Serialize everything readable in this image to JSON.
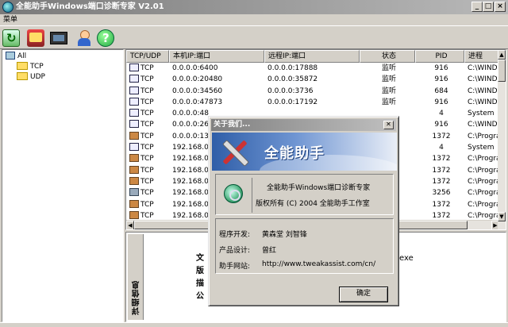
{
  "window": {
    "title": "全能助手Windows端口诊断专家 V2.01"
  },
  "menu": {
    "items": [
      "菜单"
    ]
  },
  "tree": {
    "items": [
      "All",
      "TCP",
      "UDP"
    ]
  },
  "table": {
    "columns": [
      "TCP/UDP",
      "本机IP:端口",
      "远程IP:端口",
      "状态",
      "PID",
      "进程"
    ],
    "rows": [
      {
        "icon": "window",
        "proto": "TCP",
        "local": "0.0.0.0:6400",
        "remote": "0.0.0.0:17888",
        "state": "监听",
        "pid": "916",
        "proc": "C:\\WIND"
      },
      {
        "icon": "window",
        "proto": "TCP",
        "local": "0.0.0.0:20480",
        "remote": "0.0.0.0:35872",
        "state": "监听",
        "pid": "916",
        "proc": "C:\\WIND"
      },
      {
        "icon": "window",
        "proto": "TCP",
        "local": "0.0.0.0:34560",
        "remote": "0.0.0.0:3736",
        "state": "监听",
        "pid": "684",
        "proc": "C:\\WIND"
      },
      {
        "icon": "window",
        "proto": "TCP",
        "local": "0.0.0.0:47873",
        "remote": "0.0.0.0:17192",
        "state": "监听",
        "pid": "916",
        "proc": "C:\\WIND"
      },
      {
        "icon": "window",
        "proto": "TCP",
        "local": "0.0.0.0:48",
        "remote": "",
        "state": "",
        "pid": "4",
        "proc": "System"
      },
      {
        "icon": "window",
        "proto": "TCP",
        "local": "0.0.0.0:26",
        "remote": "",
        "state": "",
        "pid": "916",
        "proc": "C:\\WIND"
      },
      {
        "icon": "program",
        "proto": "TCP",
        "local": "0.0.0.0:13",
        "remote": "",
        "state": "",
        "pid": "1372",
        "proc": "C:\\Progra"
      },
      {
        "icon": "window",
        "proto": "TCP",
        "local": "192.168.0.",
        "remote": "",
        "state": "",
        "pid": "4",
        "proc": "System"
      },
      {
        "icon": "program",
        "proto": "TCP",
        "local": "192.168.0.",
        "remote": "",
        "state": "",
        "pid": "1372",
        "proc": "C:\\Progra"
      },
      {
        "icon": "program",
        "proto": "TCP",
        "local": "192.168.0.",
        "remote": "",
        "state": "",
        "pid": "1372",
        "proc": "C:\\Progra"
      },
      {
        "icon": "program",
        "proto": "TCP",
        "local": "192.168.0.",
        "remote": "",
        "state": "",
        "pid": "1372",
        "proc": "C:\\Progra"
      },
      {
        "icon": "globe",
        "proto": "TCP",
        "local": "192.168.0.",
        "remote": "",
        "state": "",
        "pid": "3256",
        "proc": "C:\\Progra"
      },
      {
        "icon": "program",
        "proto": "TCP",
        "local": "192.168.0.",
        "remote": "",
        "state": "",
        "pid": "1372",
        "proc": "C:\\Progra"
      },
      {
        "icon": "program",
        "proto": "TCP",
        "local": "192.168.0.",
        "remote": "",
        "state": "",
        "pid": "1372",
        "proc": "C:\\Progra"
      },
      {
        "icon": "program",
        "proto": "TCP",
        "local": "192.168.0.",
        "remote": "",
        "state": "",
        "pid": "1372",
        "proc": "C:\\Progra"
      }
    ]
  },
  "detail": {
    "tab_label": "详细信息",
    "lines": [
      "文",
      "版",
      "描",
      "公"
    ],
    "right_text": "exe"
  },
  "dialog": {
    "title": "关于我们...",
    "banner_text": "全能助手",
    "product_line": "全能助手Windows端口诊断专家",
    "copyright_line": "版权所有 (C) 2004 全能助手工作室",
    "dev_label": "程序开发:",
    "dev_value": "黄森堂 刘智锋",
    "design_label": "产品设计:",
    "design_value": "曾红",
    "site_label": "助手网站:",
    "site_value": "http://www.tweakassist.com/cn/",
    "ok_label": "确定"
  },
  "colors": {
    "dialog_title_start": "#808080",
    "banner_start": "#2f5ea8",
    "face": "#d4d0c8"
  }
}
